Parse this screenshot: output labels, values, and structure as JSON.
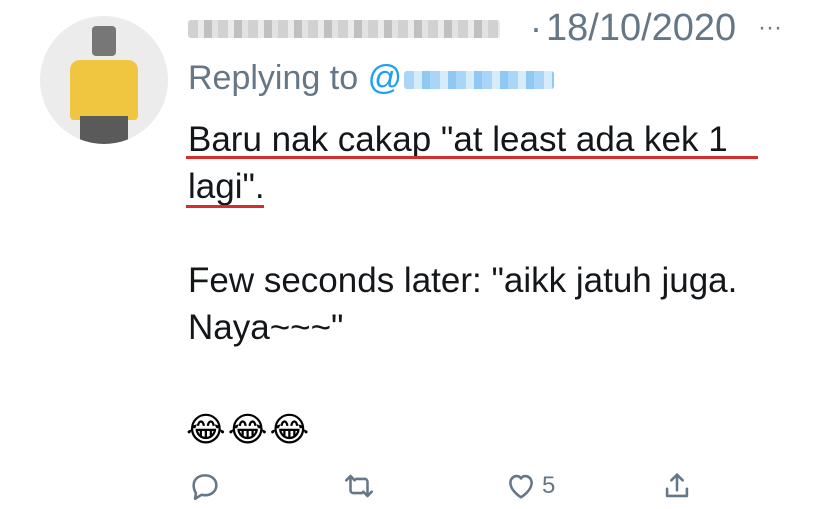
{
  "header": {
    "separator": "·",
    "timestamp": "18/10/2020",
    "more_label": "···"
  },
  "reply": {
    "prefix": "Replying to",
    "at_sign": "@"
  },
  "tweet": {
    "line1": "Baru nak cakap \"at least ada kek 1",
    "line2": "lagi\".",
    "line3": "",
    "line4": "Few seconds later: \"aikk jatuh juga.",
    "line5": "Naya~~~\""
  },
  "emojis": "😂😂😂",
  "actions": {
    "reply_icon": "reply-icon",
    "retweet_icon": "retweet-icon",
    "like_icon": "heart-icon",
    "like_count": "5",
    "share_icon": "share-icon"
  },
  "colors": {
    "secondary_text": "#657786",
    "link_blue": "#1da1f2",
    "underline_red": "#d62d2d",
    "body_text": "#14171a"
  }
}
